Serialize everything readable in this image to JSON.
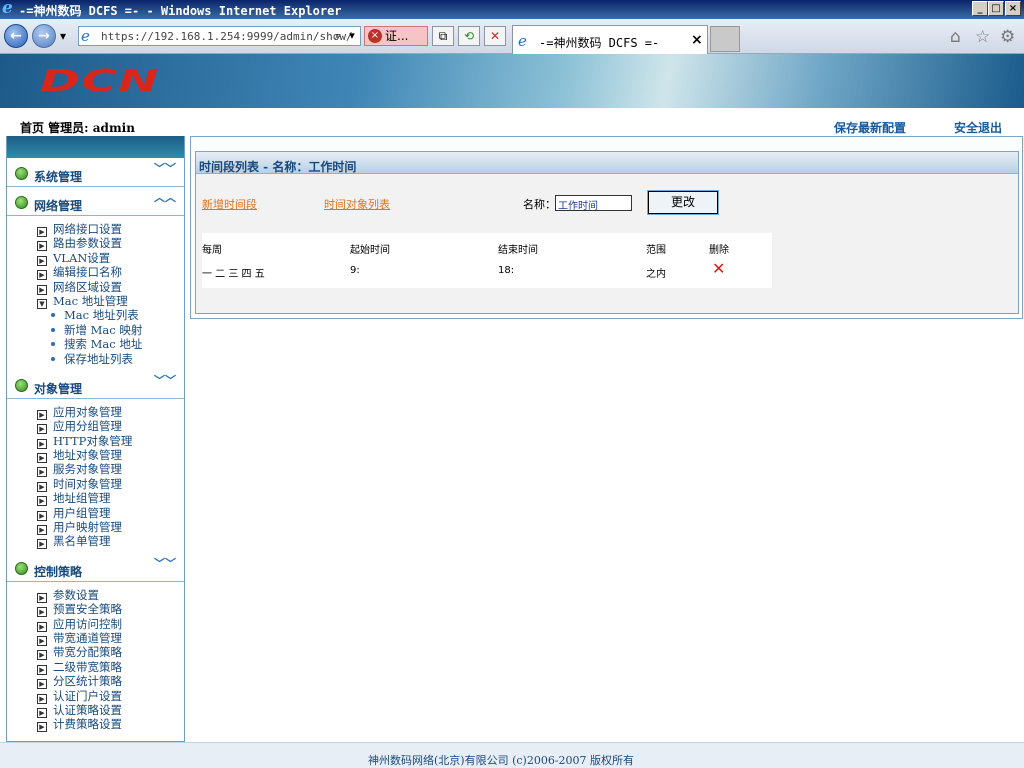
{
  "window": {
    "title": "-=神州数码 DCFS =- - Windows Internet Explorer",
    "minimize": "_",
    "restore": "□",
    "close": "×"
  },
  "browser": {
    "back_glyph": "←",
    "forward_glyph": "→",
    "dropdown_glyph": "▾",
    "url": "https://192.168.1.254:9999/admin/show/",
    "search_glyph": "⌕",
    "addr_dropdown_glyph": "▾",
    "cert_error_glyph": "×",
    "cert_error": "证...",
    "compat_glyph": "⧉",
    "refresh_glyph": "⟲",
    "stop_glyph": "✕",
    "tab_title": "-=神州数码 DCFS =-",
    "tab_close": "×",
    "home_glyph": "⌂",
    "favorites_glyph": "☆",
    "tools_glyph": "⚙"
  },
  "banner": {
    "logo": "DCN"
  },
  "header": {
    "home_admin": "首页 管理员: admin",
    "save_config": "保存最新配置",
    "logout": "安全退出"
  },
  "sidebar": {
    "sections": [
      {
        "name": "系统管理",
        "chevron": "﹀﹀"
      },
      {
        "name": "网络管理",
        "chevron": "︿︿",
        "items": [
          "网络接口设置",
          "路由参数设置",
          "VLAN设置",
          "编辑接口名称",
          "网络区域设置",
          "Mac 地址管理"
        ],
        "subitems": [
          "Mac 地址列表",
          "新增 Mac 映射",
          "搜索 Mac 地址",
          "保存地址列表"
        ]
      },
      {
        "name": "对象管理",
        "chevron": "﹀﹀",
        "items": [
          "应用对象管理",
          "应用分组管理",
          "HTTP对象管理",
          "地址对象管理",
          "服务对象管理",
          "时间对象管理",
          "地址组管理",
          "用户组管理",
          "用户映射管理",
          "黑名单管理"
        ]
      },
      {
        "name": "控制策略",
        "chevron": "﹀﹀",
        "items": [
          "参数设置",
          "预置安全策略",
          "应用访问控制",
          "带宽通道管理",
          "带宽分配策略",
          "二级带宽策略",
          "分区统计策略",
          "认证门户设置",
          "认证策略设置",
          "计费策略设置"
        ]
      }
    ]
  },
  "panel": {
    "title": "时间段列表 - 名称：工作时间",
    "new_timeslot": "新增时间段",
    "time_object_list": "时间对象列表",
    "name_label": "名称：",
    "name_value": "工作时间",
    "change_button": "更改",
    "table": {
      "headers": [
        "每周",
        "起始时间",
        "结束时间",
        "范围",
        "删除"
      ],
      "rows": [
        {
          "weekdays": "一 二 三 四 五",
          "start": "9:",
          "end": "18:",
          "range": "之内",
          "delete_glyph": "✕"
        }
      ]
    }
  },
  "footer": {
    "copyright": "神州数码网络(北京)有限公司 (c)2006-2007 版权所有"
  }
}
